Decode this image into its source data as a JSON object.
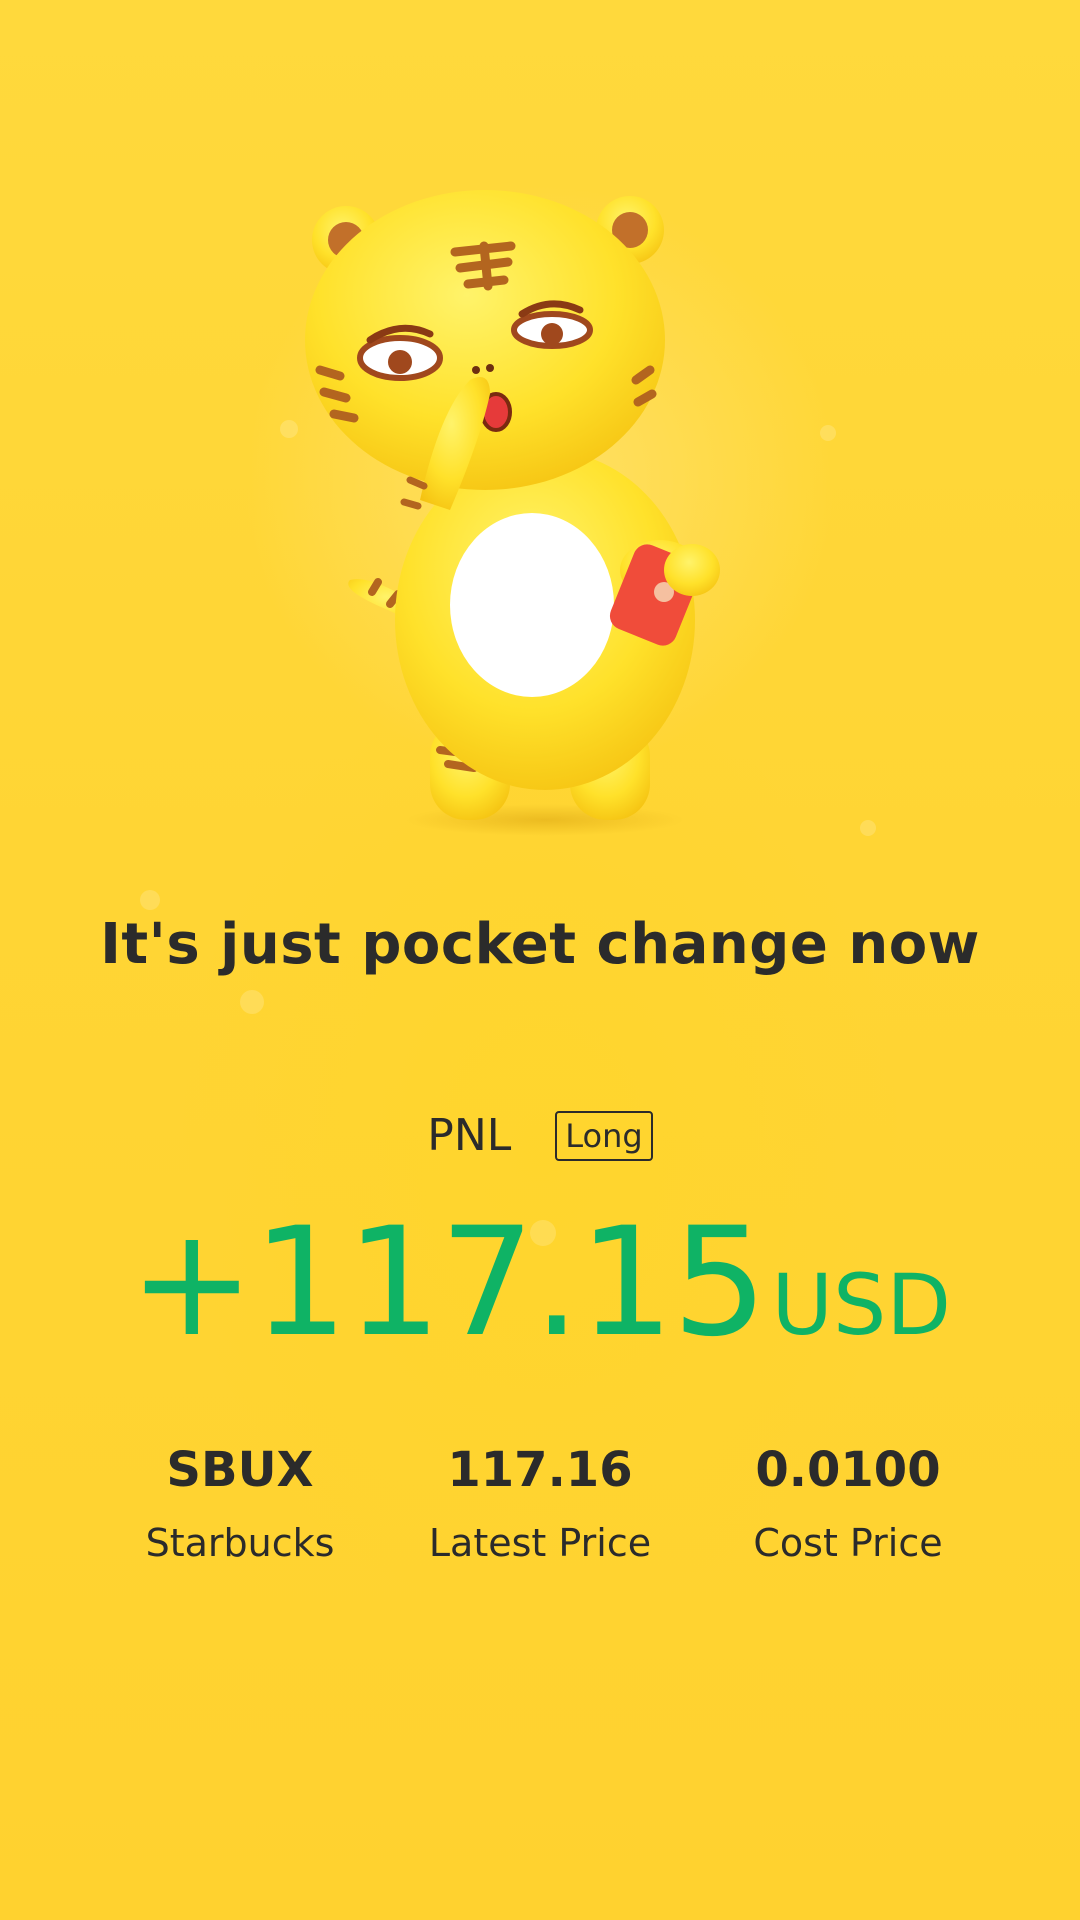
{
  "headline": "It's just pocket change now",
  "pnl": {
    "label": "PNL",
    "position_badge": "Long"
  },
  "amount": {
    "value": "+117.15",
    "unit": "USD",
    "color": "#0fb365"
  },
  "stats": [
    {
      "value": "SBUX",
      "label": "Starbucks"
    },
    {
      "value": "117.16",
      "label": "Latest Price"
    },
    {
      "value": "0.0100",
      "label": "Cost Price"
    }
  ],
  "theme": {
    "background": "#ffd534",
    "text": "#2b2b2b"
  },
  "illustration": {
    "icon": "tiger-mascot-icon"
  }
}
